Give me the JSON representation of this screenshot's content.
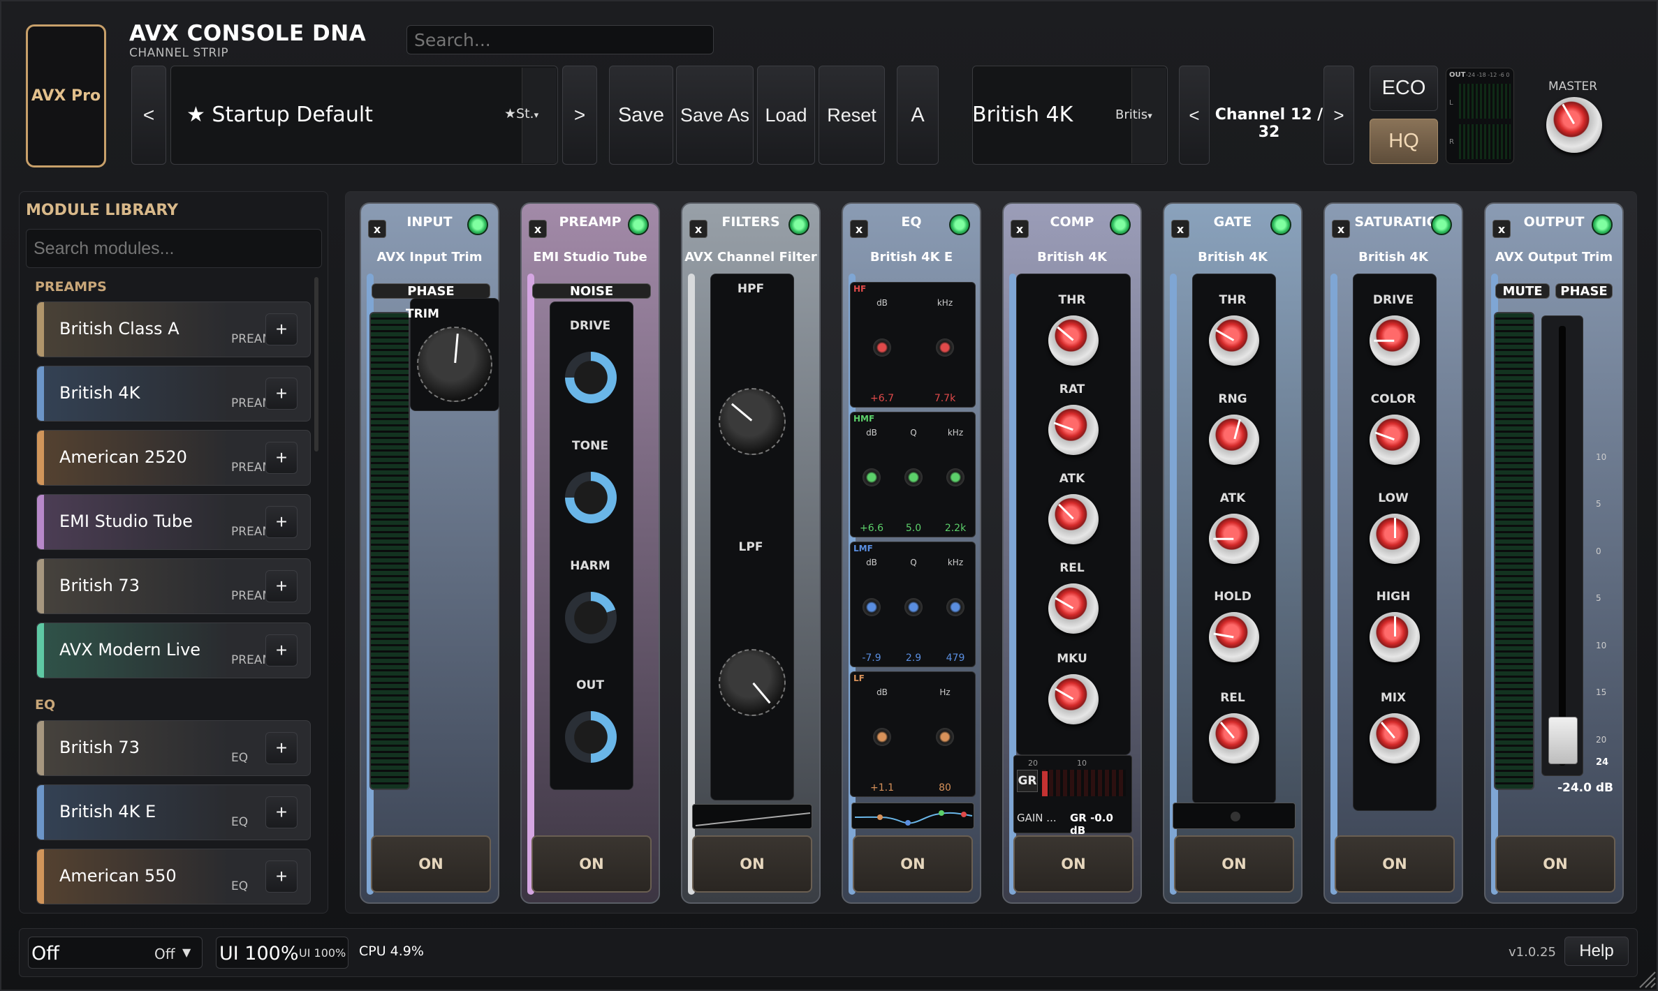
{
  "header": {
    "logo_label": "AVX Pro",
    "title": "AVX CONSOLE DNA",
    "subtitle": "CHANNEL STRIP",
    "search_placeholder": "Search...",
    "preset_prev": "<",
    "preset_next": ">",
    "preset_name": "★ Startup Default",
    "preset_tag": "★St.",
    "save": "Save",
    "save_as": "Save As",
    "load": "Load",
    "reset": "Reset",
    "ab": "A",
    "profile_name": "British 4K",
    "profile_tag": "Britis",
    "channel_prev": "<",
    "channel_label": "Channel 12 / 32",
    "channel_next": ">",
    "eco": "ECO",
    "hq": "HQ",
    "out_meter_label": "OUT",
    "out_meter_scale": "-24 -18 -12 -6 0",
    "out_l": "L",
    "out_r": "R",
    "master_label": "MASTER"
  },
  "library": {
    "title": "MODULE LIBRARY",
    "search_placeholder": "Search modules...",
    "categories": [
      {
        "name": "PREAMPS",
        "items": [
          {
            "name": "British Class A",
            "tag": "PREAM",
            "color": "#b0956b"
          },
          {
            "name": "British 4K",
            "tag": "PREAM",
            "color": "#6c95c8"
          },
          {
            "name": "American 2520",
            "tag": "PREAM",
            "color": "#d1955a"
          },
          {
            "name": "EMI Studio Tube",
            "tag": "PREAM",
            "color": "#b788c9"
          },
          {
            "name": "British 73",
            "tag": "PREAM",
            "color": "#a6977f"
          },
          {
            "name": "AVX Modern Live",
            "tag": "PREAM",
            "color": "#5ec9a4"
          }
        ]
      },
      {
        "name": "EQ",
        "items": [
          {
            "name": "British 73",
            "tag": "EQ",
            "color": "#a6977f"
          },
          {
            "name": "British 4K E",
            "tag": "EQ",
            "color": "#6c95c8"
          },
          {
            "name": "American 550",
            "tag": "EQ",
            "color": "#d1955a"
          }
        ]
      }
    ],
    "add_label": "+"
  },
  "modules": [
    {
      "id": "input",
      "title": "INPUT",
      "sub": "AVX Input Trim",
      "on": "ON",
      "phase": "PHASE",
      "trim": "TRIM"
    },
    {
      "id": "preamp",
      "title": "PREAMP",
      "sub": "EMI Studio Tube",
      "on": "ON",
      "noise": "NOISE",
      "knobs": [
        "DRIVE",
        "TONE",
        "HARM",
        "OUT"
      ]
    },
    {
      "id": "filters",
      "title": "FILTERS",
      "sub": "AVX Channel Filter",
      "on": "ON",
      "hpf": "HPF",
      "lpf": "LPF"
    },
    {
      "id": "eq",
      "title": "EQ",
      "sub": "British 4K E",
      "on": "ON",
      "bands": [
        {
          "name": "HF",
          "cols": [
            "dB",
            "kHz"
          ],
          "vals": [
            "+6.7",
            "7.7k"
          ],
          "color": "#e04a4a"
        },
        {
          "name": "HMF",
          "cols": [
            "dB",
            "Q",
            "kHz"
          ],
          "vals": [
            "+6.6",
            "5.0",
            "2.2k"
          ],
          "color": "#5cd06a"
        },
        {
          "name": "LMF",
          "cols": [
            "dB",
            "Q",
            "kHz"
          ],
          "vals": [
            "-7.9",
            "2.9",
            "479"
          ],
          "color": "#5a8ee0"
        },
        {
          "name": "LF",
          "cols": [
            "dB",
            "Hz"
          ],
          "vals": [
            "+1.1",
            "80"
          ],
          "color": "#d8925a"
        }
      ]
    },
    {
      "id": "comp",
      "title": "COMP",
      "sub": "British 4K",
      "on": "ON",
      "knobs": [
        "THR",
        "RAT",
        "ATK",
        "REL",
        "MKU"
      ],
      "gr_label": "GR",
      "gr_scale_a": "20",
      "gr_scale_b": "10",
      "gain": "GAIN ...",
      "gr_value": "GR -0.0 dB"
    },
    {
      "id": "gate",
      "title": "GATE",
      "sub": "British 4K",
      "on": "ON",
      "knobs": [
        "THR",
        "RNG",
        "ATK",
        "HOLD",
        "REL"
      ]
    },
    {
      "id": "saturation",
      "title": "SATURATION",
      "sub": "British 4K",
      "on": "ON",
      "knobs": [
        "DRIVE",
        "COLOR",
        "LOW",
        "HIGH",
        "MIX"
      ]
    },
    {
      "id": "output",
      "title": "OUTPUT",
      "sub": "AVX Output Trim",
      "on": "ON",
      "mute": "MUTE",
      "phase": "PHASE",
      "fader_value": "-24.0 dB",
      "fader_level": "-24.0 dB",
      "scale": [
        "10",
        "5",
        "0",
        "5",
        "10",
        "15",
        "20",
        "24"
      ]
    }
  ],
  "footer": {
    "select_value": "Off",
    "select_tag": "Off",
    "ui_scale": "UI 100%",
    "ui_scale_tag": "UI 100%",
    "cpu": "CPU 4.9%",
    "version": "v1.0.25",
    "help": "Help"
  }
}
